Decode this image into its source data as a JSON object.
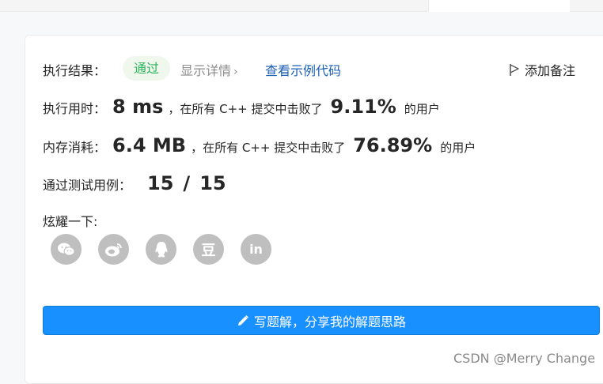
{
  "result": {
    "label": "执行结果：",
    "status": "通过",
    "details_link": "显示详情",
    "details_chevron": "›",
    "example_code_link": "查看示例代码",
    "note_button": "添加备注"
  },
  "runtime": {
    "label": "执行用时：",
    "value": "8 ms",
    "text_before": "，在所有 C++ 提交中击败了",
    "percent": "9.11%",
    "text_after": "的用户"
  },
  "memory": {
    "label": "内存消耗：",
    "value": "6.4 MB",
    "text_before": "，在所有 C++ 提交中击败了",
    "percent": "76.89%",
    "text_after": "的用户"
  },
  "tests": {
    "label": "通过测试用例：",
    "passed": "15",
    "separator": "/",
    "total": "15"
  },
  "share": {
    "label": "炫耀一下:",
    "icons": [
      "wechat-icon",
      "weibo-icon",
      "qq-icon",
      "douban-icon",
      "linkedin-icon"
    ],
    "douban_glyph": "豆",
    "linkedin_glyph": "in"
  },
  "solution_button": "写题解，分享我的解题思路",
  "watermark": "CSDN @Merry Change",
  "colors": {
    "pass_green": "#2db55d",
    "pass_bg": "#f0f7ec",
    "link_blue": "#1a5fb4",
    "button_blue": "#1890ff",
    "icon_gray": "#bfbfbf"
  }
}
